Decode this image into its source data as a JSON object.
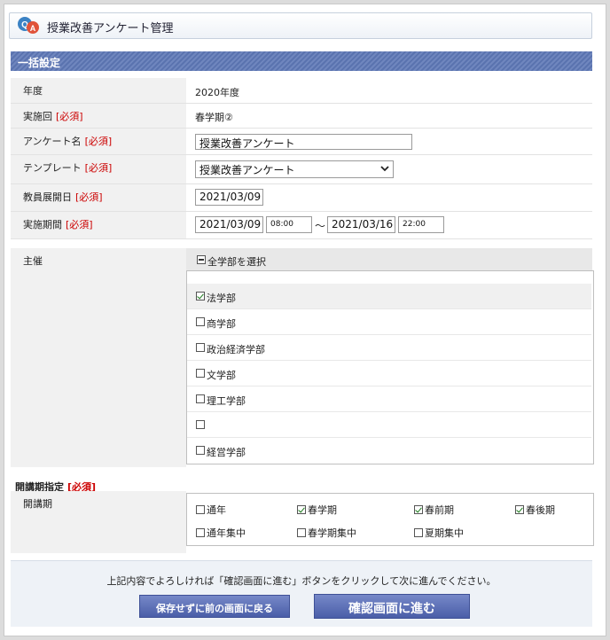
{
  "header": {
    "title": "授業改善アンケート管理",
    "icon": "qa-icon"
  },
  "section": {
    "title": "一括設定"
  },
  "required_label": "[必須]",
  "form": {
    "year": {
      "label": "年度",
      "value": "2020年度"
    },
    "round": {
      "label": "実施回",
      "value": "春学期②"
    },
    "survey_name": {
      "label": "アンケート名",
      "value": "授業改善アンケート"
    },
    "template": {
      "label": "テンプレート",
      "value": "授業改善アンケート"
    },
    "teacher_open_date": {
      "label": "教員展開日",
      "value": "2021/03/09"
    },
    "period": {
      "label": "実施期間",
      "start_date": "2021/03/09",
      "start_time": "08:00",
      "separator": "～",
      "end_date": "2021/03/16",
      "end_time": "22:00"
    },
    "host": {
      "label": "主催",
      "select_all": "全学部を選択",
      "faculties": [
        {
          "name": "法学部",
          "checked": true
        },
        {
          "name": "商学部",
          "checked": false
        },
        {
          "name": "政治経済学部",
          "checked": false
        },
        {
          "name": "文学部",
          "checked": false
        },
        {
          "name": "理工学部",
          "checked": false
        },
        {
          "name": "",
          "checked": false
        },
        {
          "name": "経営学部",
          "checked": false
        }
      ]
    },
    "term_spec": {
      "heading": "開講期指定",
      "label": "開講期",
      "options": [
        {
          "name": "通年",
          "checked": false
        },
        {
          "name": "春学期",
          "checked": true
        },
        {
          "name": "春前期",
          "checked": true
        },
        {
          "name": "春後期",
          "checked": true
        },
        {
          "name": "通年集中",
          "checked": false
        },
        {
          "name": "春学期集中",
          "checked": false
        },
        {
          "name": "夏期集中",
          "checked": false
        }
      ]
    }
  },
  "footer": {
    "notice": "上記内容でよろしければ「確認画面に進む」ボタンをクリックして次に進んでください。",
    "back_button": "保存せずに前の画面に戻る",
    "confirm_button": "確認画面に進む"
  },
  "colors": {
    "accent": "#5a73af",
    "required": "#cc0000",
    "button": "#4a5ea8"
  }
}
